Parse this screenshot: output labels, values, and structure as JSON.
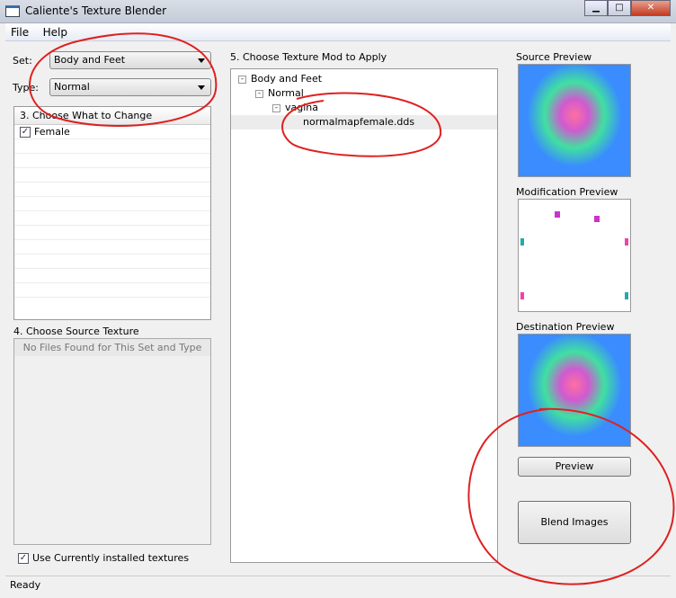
{
  "window": {
    "title": "Caliente's Texture Blender",
    "minimize": "▁",
    "maximize": "□",
    "close": "✕"
  },
  "menu": [
    "File",
    "Help"
  ],
  "set": {
    "label": "Set:",
    "value": "Body and Feet"
  },
  "type": {
    "label": "Type:",
    "value": "Normal"
  },
  "change": {
    "header": "3. Choose What to Change",
    "items": [
      {
        "label": "Female",
        "checked": true
      }
    ]
  },
  "source": {
    "header": "4. Choose Source Texture",
    "empty": "No Files Found for This Set and Type"
  },
  "use_installed": {
    "label": "Use Currently installed textures",
    "checked": true
  },
  "mod": {
    "header": "5. Choose Texture Mod to Apply",
    "tree": [
      "Body and Feet",
      "Normal",
      "vagina",
      "normalmapfemale.dds"
    ]
  },
  "previews": {
    "source": "Source Preview",
    "modification": "Modification Preview",
    "destination": "Destination Preview"
  },
  "buttons": {
    "preview": "Preview",
    "blend": "Blend Images"
  },
  "status": "Ready",
  "annotation_color": "#e02020"
}
